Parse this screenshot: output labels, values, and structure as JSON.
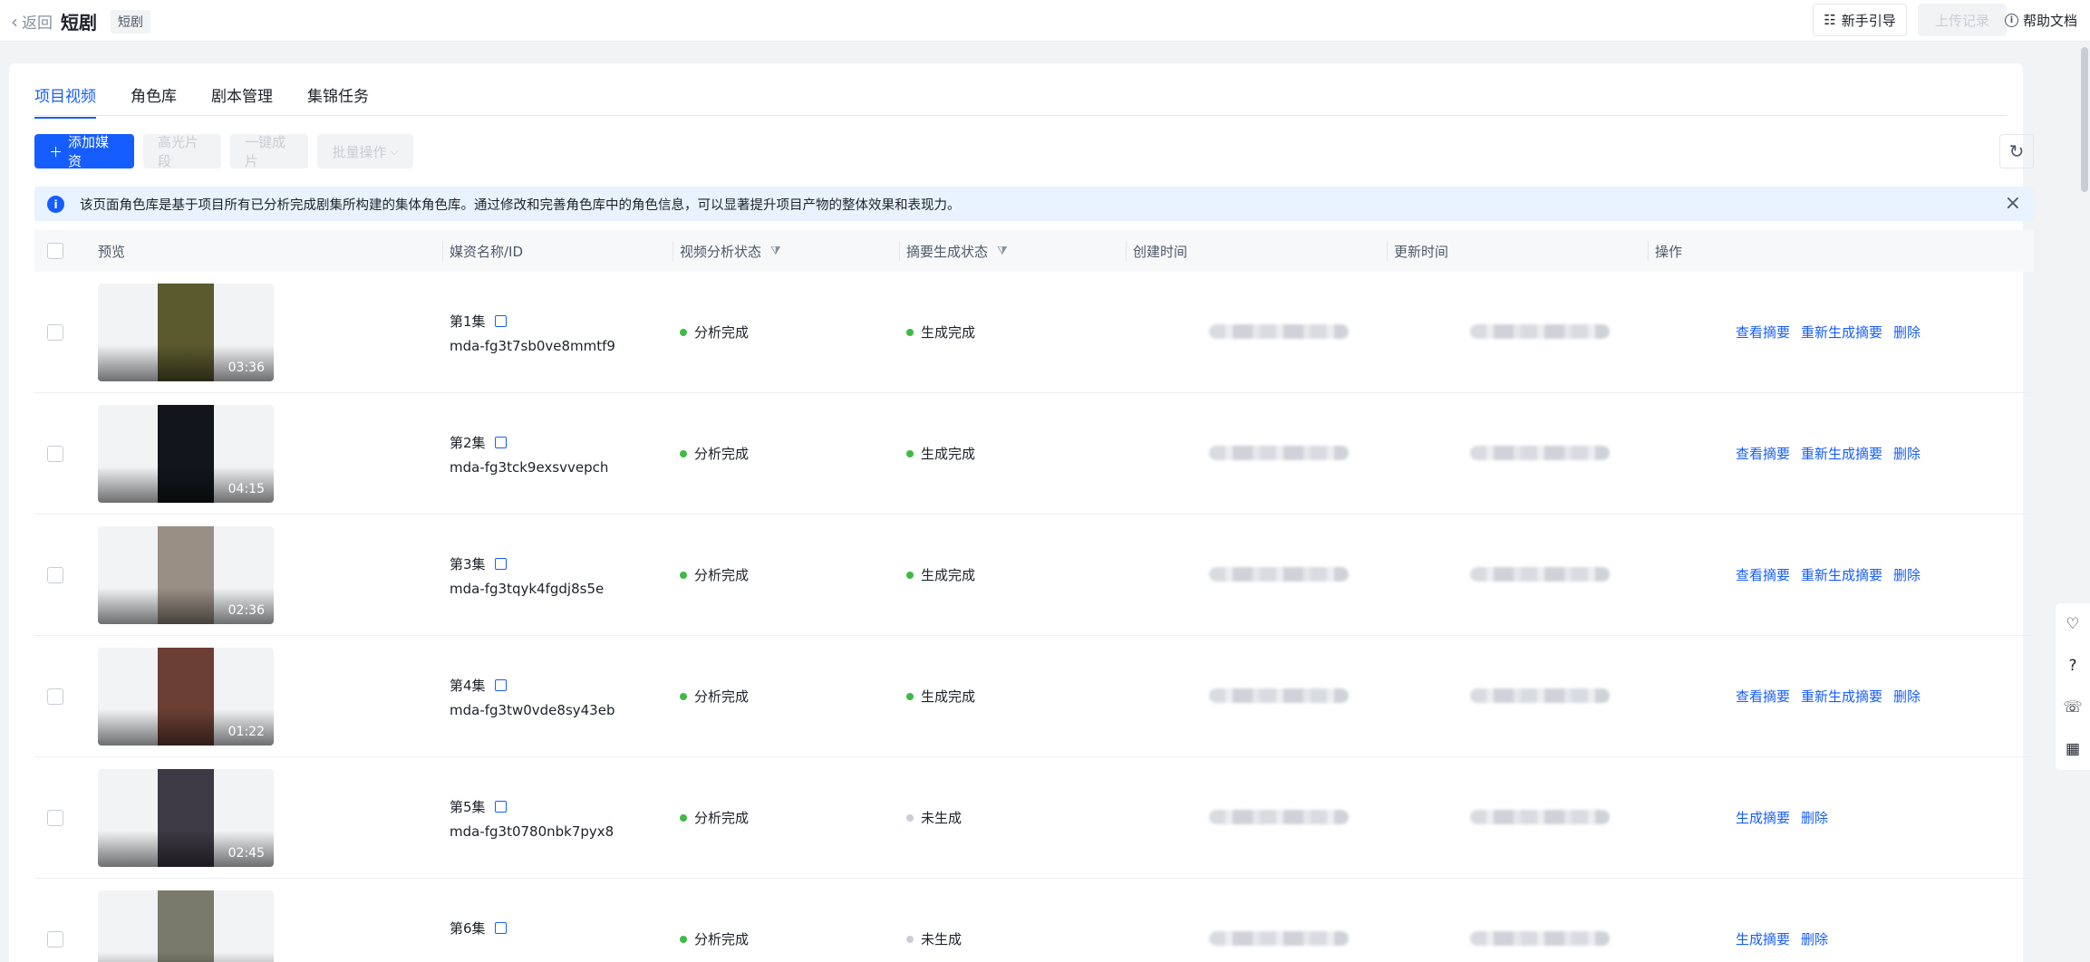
{
  "header": {
    "back_label": "返回",
    "title": "短剧",
    "tag": "短剧",
    "guide_label": "新手引导",
    "upload_label": "上传记录",
    "help_label": "帮助文档"
  },
  "tabs": [
    {
      "label": "项目视频",
      "active": true
    },
    {
      "label": "角色库",
      "active": false
    },
    {
      "label": "剧本管理",
      "active": false
    },
    {
      "label": "集锦任务",
      "active": false
    }
  ],
  "toolbar": {
    "add_label": "添加媒资",
    "highlight_label": "高光片段",
    "oneclick_label": "一键成片",
    "batch_label": "批量操作"
  },
  "notice": {
    "text": "该页面角色库是基于项目所有已分析完成剧集所构建的集体角色库。通过修改和完善角色库中的角色信息，可以显著提升项目产物的整体效果和表现力。"
  },
  "table": {
    "columns": {
      "preview": "预览",
      "name": "媒资名称/ID",
      "analysis": "视频分析状态",
      "summary": "摘要生成状态",
      "created": "创建时间",
      "updated": "更新时间",
      "ops": "操作"
    },
    "rows": [
      {
        "name": "第1集",
        "id": "mda-fg3t7sb0ve8mmtf9",
        "duration": "03:36",
        "analysis": "分析完成",
        "summary": "生成完成",
        "summary_done": true,
        "ops": [
          "查看摘要",
          "重新生成摘要",
          "删除"
        ]
      },
      {
        "name": "第2集",
        "id": "mda-fg3tck9exsvvepch",
        "duration": "04:15",
        "analysis": "分析完成",
        "summary": "生成完成",
        "summary_done": true,
        "ops": [
          "查看摘要",
          "重新生成摘要",
          "删除"
        ]
      },
      {
        "name": "第3集",
        "id": "mda-fg3tqyk4fgdj8s5e",
        "duration": "02:36",
        "analysis": "分析完成",
        "summary": "生成完成",
        "summary_done": true,
        "ops": [
          "查看摘要",
          "重新生成摘要",
          "删除"
        ]
      },
      {
        "name": "第4集",
        "id": "mda-fg3tw0vde8sy43eb",
        "duration": "01:22",
        "analysis": "分析完成",
        "summary": "生成完成",
        "summary_done": true,
        "ops": [
          "查看摘要",
          "重新生成摘要",
          "删除"
        ]
      },
      {
        "name": "第5集",
        "id": "mda-fg3t0780nbk7pyx8",
        "duration": "02:45",
        "analysis": "分析完成",
        "summary": "未生成",
        "summary_done": false,
        "ops": [
          "生成摘要",
          "删除"
        ]
      },
      {
        "name": "第6集",
        "id": "",
        "duration": "",
        "analysis": "分析完成",
        "summary": "未生成",
        "summary_done": false,
        "ops": [
          "生成摘要",
          "删除"
        ]
      }
    ]
  },
  "colors": {
    "primary": "#165dff",
    "success": "#3fba45",
    "pending": "#c9cdd4"
  }
}
